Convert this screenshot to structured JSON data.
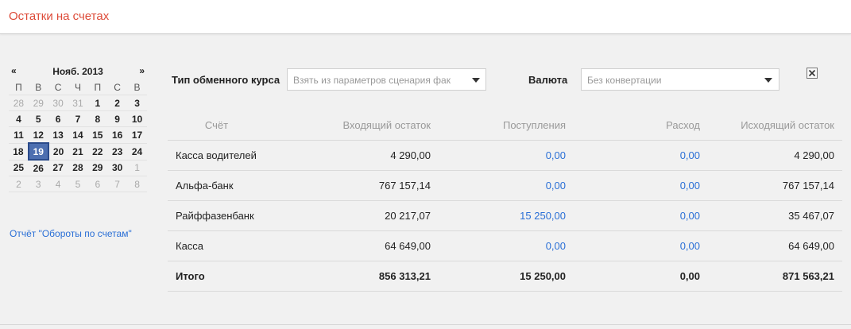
{
  "title": "Остатки на счетах",
  "calendar": {
    "prev": "«",
    "next": "»",
    "month": "Нояб. 2013",
    "weekdays": [
      "П",
      "В",
      "С",
      "Ч",
      "П",
      "С",
      "В"
    ],
    "weeks": [
      [
        {
          "d": "28",
          "o": true
        },
        {
          "d": "29",
          "o": true
        },
        {
          "d": "30",
          "o": true
        },
        {
          "d": "31",
          "o": true
        },
        {
          "d": "1"
        },
        {
          "d": "2"
        },
        {
          "d": "3"
        }
      ],
      [
        {
          "d": "4"
        },
        {
          "d": "5"
        },
        {
          "d": "6"
        },
        {
          "d": "7"
        },
        {
          "d": "8"
        },
        {
          "d": "9"
        },
        {
          "d": "10"
        }
      ],
      [
        {
          "d": "11"
        },
        {
          "d": "12"
        },
        {
          "d": "13"
        },
        {
          "d": "14"
        },
        {
          "d": "15"
        },
        {
          "d": "16"
        },
        {
          "d": "17"
        }
      ],
      [
        {
          "d": "18"
        },
        {
          "d": "19",
          "sel": true
        },
        {
          "d": "20"
        },
        {
          "d": "21"
        },
        {
          "d": "22"
        },
        {
          "d": "23"
        },
        {
          "d": "24"
        }
      ],
      [
        {
          "d": "25"
        },
        {
          "d": "26"
        },
        {
          "d": "27"
        },
        {
          "d": "28"
        },
        {
          "d": "29"
        },
        {
          "d": "30"
        },
        {
          "d": "1",
          "o": true
        }
      ],
      [
        {
          "d": "2",
          "o": true
        },
        {
          "d": "3",
          "o": true
        },
        {
          "d": "4",
          "o": true
        },
        {
          "d": "5",
          "o": true
        },
        {
          "d": "6",
          "o": true
        },
        {
          "d": "7",
          "o": true
        },
        {
          "d": "8",
          "o": true
        }
      ]
    ]
  },
  "report_link": "Отчёт \"Обороты по счетам\"",
  "filters": {
    "rate_label": "Тип обменного курса",
    "rate_placeholder": "Взять из параметров сценария фак",
    "currency_label": "Валюта",
    "currency_placeholder": "Без конвертации"
  },
  "table": {
    "headers": [
      "Счёт",
      "Входящий остаток",
      "Поступления",
      "Расход",
      "Исходящий остаток"
    ],
    "rows": [
      [
        "Касса водителей",
        "4 290,00",
        "0,00",
        "0,00",
        "4 290,00"
      ],
      [
        "Альфа-банк",
        "767 157,14",
        "0,00",
        "0,00",
        "767 157,14"
      ],
      [
        "Райффазенбанк",
        "20 217,07",
        "15 250,00",
        "0,00",
        "35 467,07"
      ],
      [
        "Касса",
        "64 649,00",
        "0,00",
        "0,00",
        "64 649,00"
      ]
    ],
    "total": [
      "Итого",
      "856 313,21",
      "15 250,00",
      "0,00",
      "871 563,21"
    ]
  },
  "colors": {
    "title": "#dd4b39",
    "link": "#2a6fd6",
    "selected_day": "#4d6fb0"
  }
}
